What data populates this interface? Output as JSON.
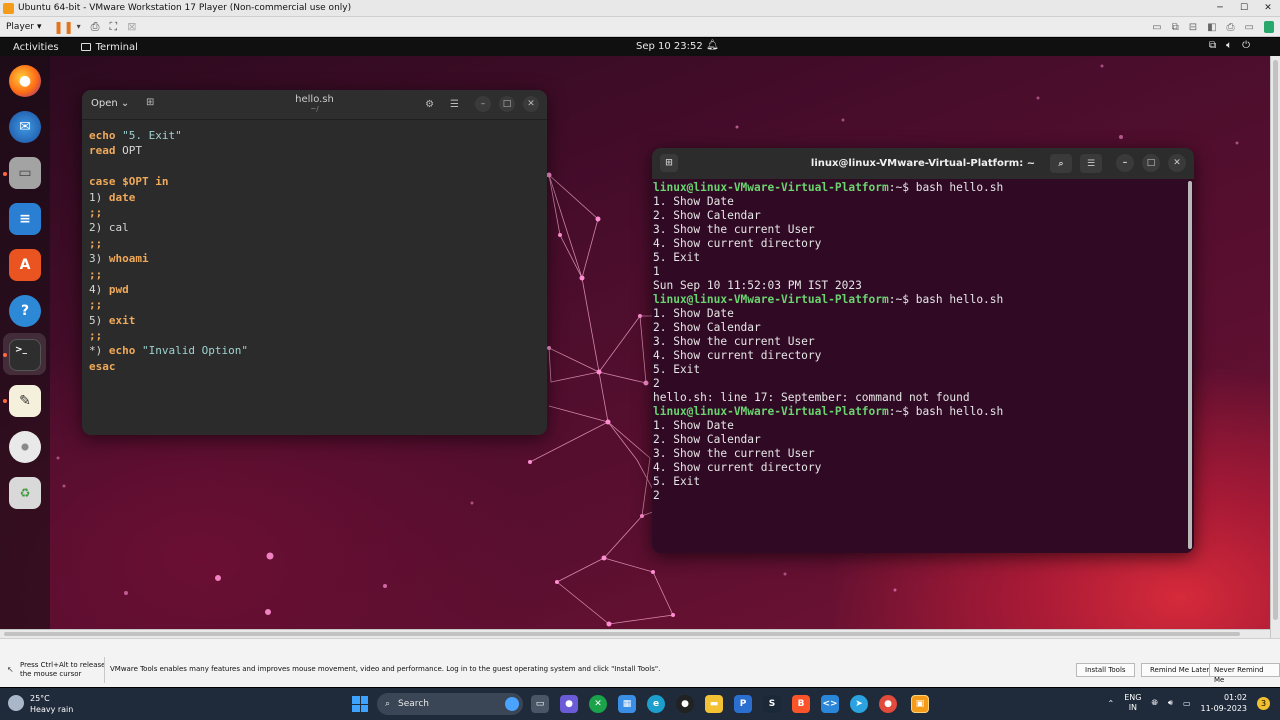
{
  "vmware": {
    "window_title": "Ubuntu 64-bit - VMware Workstation 17 Player (Non-commercial use only)",
    "player_menu": "Player",
    "notice": {
      "release_hint": "Press Ctrl+Alt to release the mouse cursor",
      "message": "VMware Tools enables many features and improves mouse movement, video and performance. Log in to the guest operating system and click \"Install Tools\".",
      "install_label": "Install Tools",
      "remind_label": "Remind Me Later",
      "never_label": "Never Remind Me"
    }
  },
  "ubuntu": {
    "activities": "Activities",
    "app_name": "Terminal",
    "datetime": "Sep 10  23:52",
    "dock": [
      "firefox-icon",
      "thunderbird-icon",
      "files-icon",
      "libreoffice-writer-icon",
      "app-center-icon",
      "help-icon",
      "terminal-icon",
      "text-editor-icon",
      "disc-icon",
      "trash-icon"
    ]
  },
  "editor": {
    "open_label": "Open",
    "title": "hello.sh",
    "subtitle": "~/",
    "lines": [
      [
        {
          "t": "echo",
          "c": "kw"
        },
        {
          "t": " ",
          "c": "plain"
        },
        {
          "t": "\"5. Exit\"",
          "c": "str"
        }
      ],
      [
        {
          "t": "read",
          "c": "kw"
        },
        {
          "t": " OPT",
          "c": "plain"
        }
      ],
      [],
      [
        {
          "t": "case",
          "c": "kw"
        },
        {
          "t": " ",
          "c": "plain"
        },
        {
          "t": "$OPT",
          "c": "kw"
        },
        {
          "t": " ",
          "c": "plain"
        },
        {
          "t": "in",
          "c": "kw"
        }
      ],
      [
        {
          "t": "1) ",
          "c": "plain"
        },
        {
          "t": "date",
          "c": "kw"
        }
      ],
      [
        {
          "t": ";;",
          "c": "kw"
        }
      ],
      [
        {
          "t": "2) cal",
          "c": "plain"
        }
      ],
      [
        {
          "t": ";;",
          "c": "kw"
        }
      ],
      [
        {
          "t": "3) ",
          "c": "plain"
        },
        {
          "t": "whoami",
          "c": "kw"
        }
      ],
      [
        {
          "t": ";;",
          "c": "kw"
        }
      ],
      [
        {
          "t": "4) ",
          "c": "plain"
        },
        {
          "t": "pwd",
          "c": "kw"
        }
      ],
      [
        {
          "t": ";;",
          "c": "kw"
        }
      ],
      [
        {
          "t": "5) ",
          "c": "plain"
        },
        {
          "t": "exit",
          "c": "kw"
        }
      ],
      [
        {
          "t": ";;",
          "c": "kw"
        }
      ],
      [
        {
          "t": "*) ",
          "c": "plain"
        },
        {
          "t": "echo",
          "c": "kw"
        },
        {
          "t": " ",
          "c": "plain"
        },
        {
          "t": "\"Invalid Option\"",
          "c": "str"
        }
      ],
      [
        {
          "t": "esac",
          "c": "kw"
        }
      ]
    ]
  },
  "terminal": {
    "title": "linux@linux-VMware-Virtual-Platform: ~",
    "prompt_user": "linux@linux-VMware-Virtual-Platform",
    "prompt_suffix": ":~$ ",
    "lines": [
      {
        "type": "prompt",
        "cmd": "bash hello.sh"
      },
      {
        "type": "out",
        "text": "1. Show Date"
      },
      {
        "type": "out",
        "text": "2. Show Calendar"
      },
      {
        "type": "out",
        "text": "3. Show the current User"
      },
      {
        "type": "out",
        "text": "4. Show current directory"
      },
      {
        "type": "out",
        "text": "5. Exit"
      },
      {
        "type": "out",
        "text": "1"
      },
      {
        "type": "out",
        "text": "Sun Sep 10 11:52:03 PM IST 2023"
      },
      {
        "type": "prompt",
        "cmd": "bash hello.sh"
      },
      {
        "type": "out",
        "text": "1. Show Date"
      },
      {
        "type": "out",
        "text": "2. Show Calendar"
      },
      {
        "type": "out",
        "text": "3. Show the current User"
      },
      {
        "type": "out",
        "text": "4. Show current directory"
      },
      {
        "type": "out",
        "text": "5. Exit"
      },
      {
        "type": "out",
        "text": "2"
      },
      {
        "type": "out",
        "text": "hello.sh: line 17: September: command not found"
      },
      {
        "type": "prompt",
        "cmd": "bash hello.sh"
      },
      {
        "type": "out",
        "text": "1. Show Date"
      },
      {
        "type": "out",
        "text": "2. Show Calendar"
      },
      {
        "type": "out",
        "text": "3. Show the current User"
      },
      {
        "type": "out",
        "text": "4. Show current directory"
      },
      {
        "type": "out",
        "text": "5. Exit"
      },
      {
        "type": "out",
        "text": "2"
      }
    ]
  },
  "taskbar": {
    "temperature": "25°C",
    "weather": "Heavy rain",
    "search_placeholder": "Search",
    "lang_1": "ENG",
    "lang_2": "IN",
    "time": "01:02",
    "date": "11-09-2023",
    "notif_count": "3"
  }
}
